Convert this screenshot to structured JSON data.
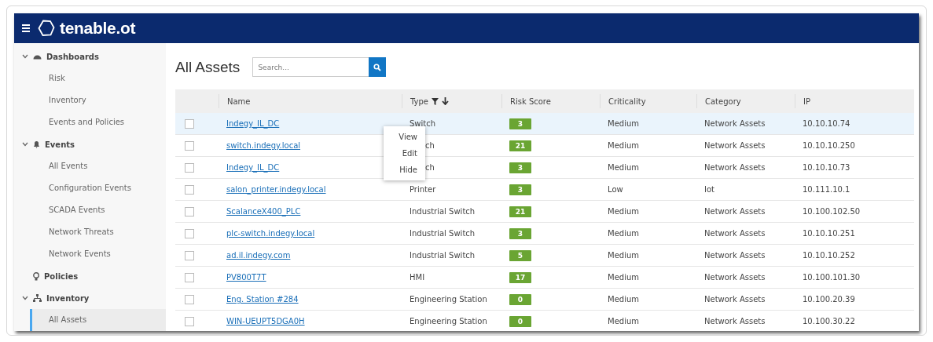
{
  "header": {
    "logo": "tenable.ot"
  },
  "sidebar": {
    "sections": [
      {
        "label": "Dashboards",
        "expanded": true,
        "children": [
          {
            "label": "Risk",
            "selected": false
          },
          {
            "label": "Inventory",
            "selected": false
          },
          {
            "label": "Events and Policies",
            "selected": false
          }
        ]
      },
      {
        "label": "Events",
        "expanded": true,
        "children": [
          {
            "label": "All Events",
            "selected": false
          },
          {
            "label": "Configuration Events",
            "selected": false
          },
          {
            "label": "SCADA Events",
            "selected": false
          },
          {
            "label": "Network Threats",
            "selected": false
          },
          {
            "label": "Network Events",
            "selected": false
          }
        ]
      },
      {
        "label": "Policies"
      },
      {
        "label": "Inventory",
        "expanded": true,
        "children": [
          {
            "label": "All Assets",
            "selected": true
          }
        ]
      }
    ]
  },
  "page": {
    "title": "All Assets",
    "search": {
      "placeholder": "Search..."
    }
  },
  "table": {
    "columns": [
      "Name",
      "Type",
      "Risk Score",
      "Criticality",
      "Category",
      "IP"
    ],
    "rows": [
      {
        "checked": false,
        "selected": true,
        "name": "Indegy_IL_DC",
        "type": "Switch",
        "risk": "3",
        "criticality": "Medium",
        "category": "Network Assets",
        "ip": "10.10.10.74"
      },
      {
        "checked": false,
        "selected": false,
        "covered": true,
        "name": "switch.indegy.local",
        "type": "ch",
        "risk": "21",
        "criticality": "Medium",
        "category": "Network Assets",
        "ip": "10.10.10.250"
      },
      {
        "checked": false,
        "selected": false,
        "covered": true,
        "name": "Indegy_IL_DC",
        "type": "ch",
        "risk": "3",
        "criticality": "Medium",
        "category": "Network Assets",
        "ip": "10.10.10.73"
      },
      {
        "checked": false,
        "selected": false,
        "name": "salon_printer.indegy.local",
        "type": "Printer",
        "risk": "3",
        "criticality": "Low",
        "category": "Iot",
        "ip": "10.111.10.1"
      },
      {
        "checked": false,
        "selected": false,
        "name": "ScalanceX400_PLC",
        "type": "Industrial Switch",
        "risk": "21",
        "criticality": "Medium",
        "category": "Network Assets",
        "ip": "10.100.102.50"
      },
      {
        "checked": false,
        "selected": false,
        "name": "plc-switch.indegy.local",
        "type": "Industrial Switch",
        "risk": "3",
        "criticality": "Medium",
        "category": "Network Assets",
        "ip": "10.10.10.251"
      },
      {
        "checked": false,
        "selected": false,
        "name": "ad.il.indegy.com",
        "type": "Industrial Switch",
        "risk": "5",
        "criticality": "Medium",
        "category": "Network Assets",
        "ip": "10.10.10.252"
      },
      {
        "checked": false,
        "selected": false,
        "name": "PV800T7T",
        "type": "HMI",
        "risk": "17",
        "criticality": "Medium",
        "category": "Network Assets",
        "ip": "10.100.101.30"
      },
      {
        "checked": false,
        "selected": false,
        "name": "Eng. Station #284",
        "type": "Engineering Station",
        "risk": "0",
        "criticality": "Medium",
        "category": "Network Assets",
        "ip": "10.100.20.39"
      },
      {
        "checked": false,
        "selected": false,
        "name": "WIN-UEUPT5DGA0H",
        "type": "Engineering Station",
        "risk": "0",
        "criticality": "Medium",
        "category": "Network Assets",
        "ip": "10.100.30.22"
      }
    ]
  },
  "context_menu": {
    "items": [
      "View",
      "Edit",
      "Hide"
    ]
  }
}
